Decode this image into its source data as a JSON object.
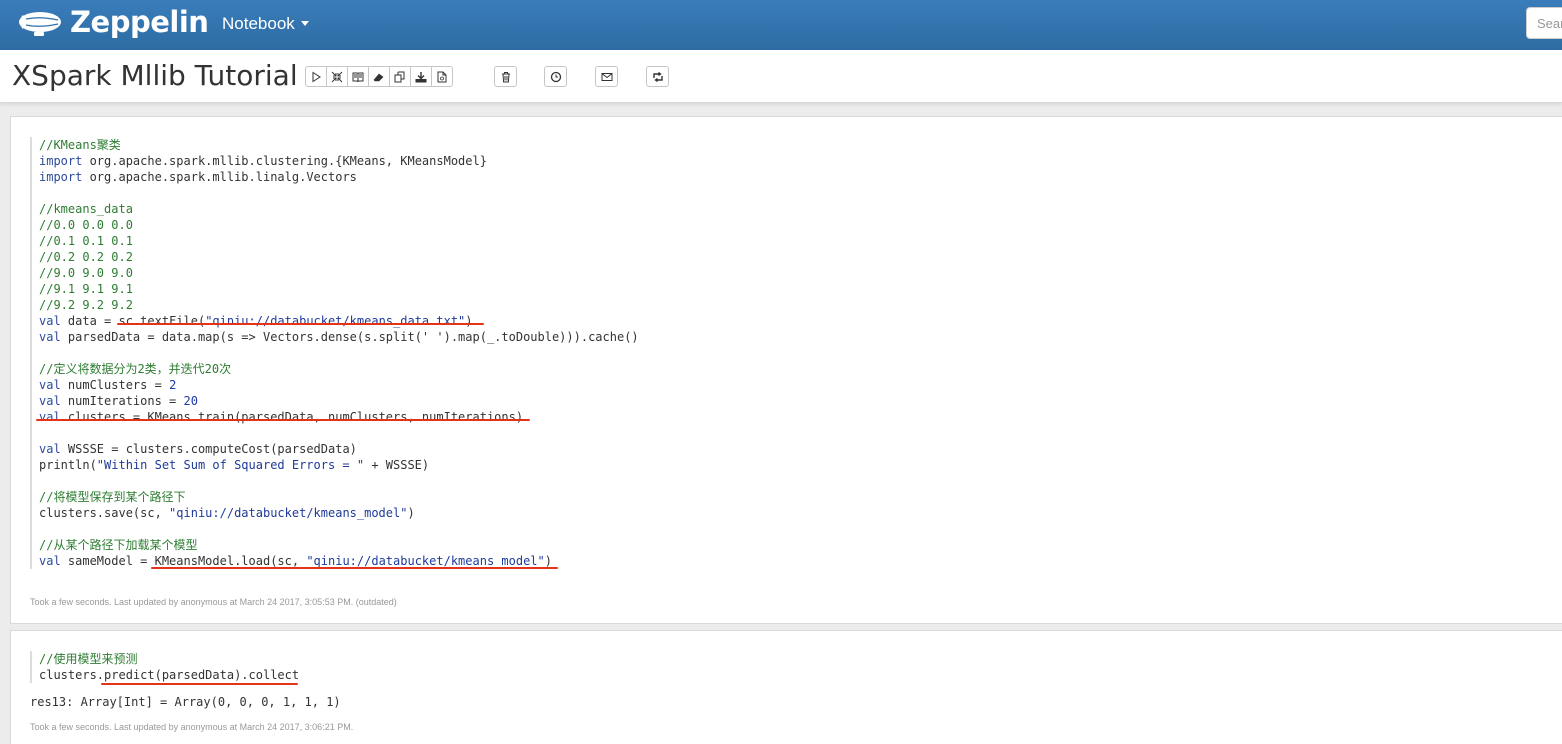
{
  "navbar": {
    "brand": "Zeppelin",
    "notebook_menu": "Notebook",
    "search_placeholder": "Search"
  },
  "notebook": {
    "title": "XSpark Mllib Tutorial"
  },
  "paragraphs": [
    {
      "code_lines": [
        "//KMeans聚类",
        "import org.apache.spark.mllib.clustering.{KMeans, KMeansModel}",
        "import org.apache.spark.mllib.linalg.Vectors",
        "",
        "//kmeans_data",
        "//0.0 0.0 0.0",
        "//0.1 0.1 0.1",
        "//0.2 0.2 0.2",
        "//9.0 9.0 9.0",
        "//9.1 9.1 9.1",
        "//9.2 9.2 9.2",
        "val data = sc.textFile(\"qiniu://databucket/kmeans_data.txt\")",
        "val parsedData = data.map(s => Vectors.dense(s.split(' ').map(_.toDouble))).cache()",
        "",
        "//定义将数据分为2类，并迭代20次",
        "val numClusters = 2",
        "val numIterations = 20",
        "val clusters = KMeans.train(parsedData, numClusters, numIterations)",
        "",
        "val WSSSE = clusters.computeCost(parsedData)",
        "println(\"Within Set Sum of Squared Errors = \" + WSSSE)",
        "",
        "//将模型保存到某个路径下",
        "clusters.save(sc, \"qiniu://databucket/kmeans_model\")",
        "",
        "//从某个路径下加载某个模型",
        "val sameModel = KMeansModel.load(sc, \"qiniu://databucket/kmeans_model\")"
      ],
      "status": "Took a few seconds. Last updated by anonymous at March 24 2017, 3:05:53 PM. (outdated)"
    },
    {
      "code_lines": [
        "//使用模型来预测",
        "clusters.predict(parsedData).collect"
      ],
      "output": "res13: Array[Int] = Array(0, 0, 0, 1, 1, 1)",
      "status": "Took a few seconds. Last updated by anonymous at March 24 2017, 3:06:21 PM."
    }
  ]
}
